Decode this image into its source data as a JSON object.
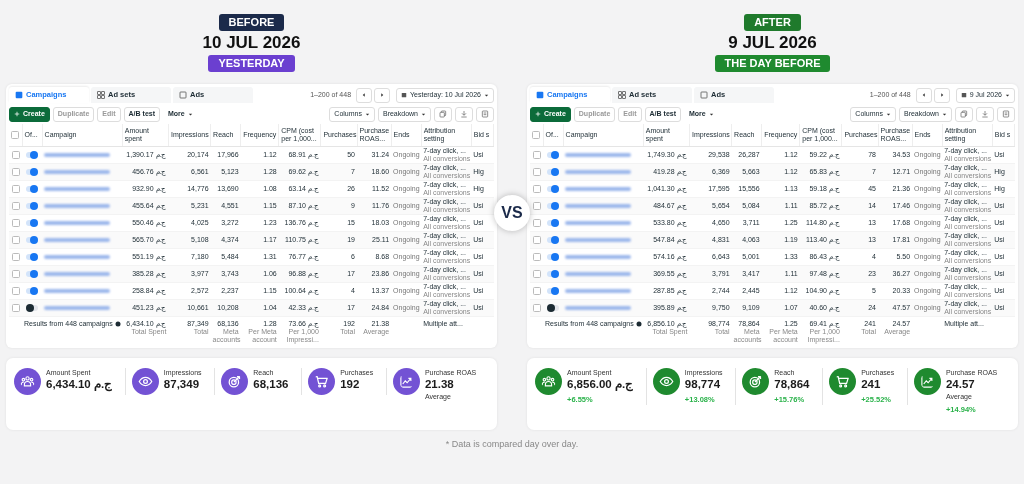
{
  "panels": [
    {
      "badge": {
        "text": "BEFORE",
        "color": "#1b2a4a"
      },
      "date": "10 JUL 2026",
      "sub_badge": {
        "text": "YESTERDAY",
        "color": "#6b3fd0"
      },
      "color": "#7352d4",
      "tabs": [
        {
          "label": "Campaigns",
          "selected": true
        },
        {
          "label": "Ad sets",
          "selected": false
        },
        {
          "label": "Ads",
          "selected": false
        }
      ],
      "pager": "1–200 of 448",
      "date_filter": "Yesterday: 10 Jul 2026",
      "toolbar": [
        {
          "label": "Create",
          "kind": "primary",
          "disabled": false
        },
        {
          "label": "Duplicate",
          "kind": "plain",
          "disabled": true
        },
        {
          "label": "Edit",
          "kind": "plain",
          "disabled": true
        },
        {
          "label": "A/B test",
          "kind": "plain",
          "disabled": false
        },
        {
          "label": "More",
          "kind": "menu",
          "disabled": false
        }
      ],
      "right_tools": [
        "Columns",
        "Breakdown"
      ],
      "select_all": false,
      "headers": [
        "Of...",
        "Campaign",
        "Amount spent",
        "Impressions",
        "Reach",
        "Frequency",
        "CPM (cost per 1,000...",
        "Purchases",
        "Purchase ROAS...",
        "Ends",
        "Attribution setting",
        "Bid s"
      ],
      "rows": [
        {
          "checked": false,
          "on": true,
          "amount_spent": "1,390.17 ج.م",
          "impressions": "20,174",
          "reach": "17,966",
          "frequency": "1.12",
          "cpm": "68.91 ج.م",
          "purchases": "50",
          "purchase_roas": "31.24",
          "ends": "Ongoing",
          "attribution": "7-day click, ...",
          "attribution_note": "All conversions",
          "bid": "Usi"
        },
        {
          "checked": false,
          "on": true,
          "amount_spent": "456.76 ج.م",
          "impressions": "6,561",
          "reach": "5,123",
          "frequency": "1.28",
          "cpm": "69.62 ج.م",
          "purchases": "7",
          "purchase_roas": "18.60",
          "ends": "Ongoing",
          "attribution": "7-day click, ...",
          "attribution_note": "All conversions",
          "bid": "Hig"
        },
        {
          "checked": false,
          "on": true,
          "amount_spent": "932.90 ج.م",
          "impressions": "14,776",
          "reach": "13,690",
          "frequency": "1.08",
          "cpm": "63.14 ج.م",
          "purchases": "26",
          "purchase_roas": "11.52",
          "ends": "Ongoing",
          "attribution": "7-day click, ...",
          "attribution_note": "All conversions",
          "bid": "Hig"
        },
        {
          "checked": false,
          "on": true,
          "amount_spent": "455.64 ج.م",
          "impressions": "5,231",
          "reach": "4,551",
          "frequency": "1.15",
          "cpm": "87.10 ج.م",
          "purchases": "9",
          "purchase_roas": "11.76",
          "ends": "Ongoing",
          "attribution": "7-day click, ...",
          "attribution_note": "All conversions",
          "bid": "Usi"
        },
        {
          "checked": false,
          "on": true,
          "amount_spent": "550.46 ج.م",
          "impressions": "4,025",
          "reach": "3,272",
          "frequency": "1.23",
          "cpm": "136.76 ج.م",
          "purchases": "15",
          "purchase_roas": "18.03",
          "ends": "Ongoing",
          "attribution": "7-day click, ...",
          "attribution_note": "All conversions",
          "bid": "Usi"
        },
        {
          "checked": false,
          "on": true,
          "amount_spent": "565.70 ج.م",
          "impressions": "5,108",
          "reach": "4,374",
          "frequency": "1.17",
          "cpm": "110.75 ج.م",
          "purchases": "19",
          "purchase_roas": "25.11",
          "ends": "Ongoing",
          "attribution": "7-day click, ...",
          "attribution_note": "All conversions",
          "bid": "Usi"
        },
        {
          "checked": false,
          "on": true,
          "amount_spent": "551.19 ج.م",
          "impressions": "7,180",
          "reach": "5,484",
          "frequency": "1.31",
          "cpm": "76.77 ج.م",
          "purchases": "6",
          "purchase_roas": "8.68",
          "ends": "Ongoing",
          "attribution": "7-day click, ...",
          "attribution_note": "All conversions",
          "bid": "Usi"
        },
        {
          "checked": false,
          "on": true,
          "amount_spent": "385.28 ج.م",
          "impressions": "3,977",
          "reach": "3,743",
          "frequency": "1.06",
          "cpm": "96.88 ج.م",
          "purchases": "17",
          "purchase_roas": "23.86",
          "ends": "Ongoing",
          "attribution": "7-day click, ...",
          "attribution_note": "All conversions",
          "bid": "Usi"
        },
        {
          "checked": false,
          "on": true,
          "amount_spent": "258.84 ج.م",
          "impressions": "2,572",
          "reach": "2,237",
          "frequency": "1.15",
          "cpm": "100.64 ج.م",
          "purchases": "4",
          "purchase_roas": "13.37",
          "ends": "Ongoing",
          "attribution": "7-day click, ...",
          "attribution_note": "All conversions",
          "bid": "Usi"
        },
        {
          "checked": false,
          "on": false,
          "amount_spent": "451.23 ج.م",
          "impressions": "10,661",
          "reach": "10,208",
          "frequency": "1.04",
          "cpm": "42.33 ج.م",
          "purchases": "17",
          "purchase_roas": "24.84",
          "ends": "Ongoing",
          "attribution": "7-day click, ...",
          "attribution_note": "All conversions",
          "bid": "Usi"
        }
      ],
      "totals": {
        "label": "Results from 448 campaigns",
        "values": [
          {
            "value": "6,434.10 ج.م",
            "note": "Total Spent"
          },
          {
            "value": "87,349",
            "note": "Total"
          },
          {
            "value": "68,136",
            "note": "Meta accounts"
          },
          {
            "value": "1.28",
            "note": "Per Meta account"
          },
          {
            "value": "73.66 ج.م",
            "note": "Per 1,000 Impressi..."
          },
          {
            "value": "192",
            "note": "Total"
          },
          {
            "value": "21.38",
            "note": "Average"
          }
        ],
        "attribution": "Multiple att..."
      },
      "stats": [
        {
          "label": "Amount Spent",
          "value": "6,434.10 ج.م"
        },
        {
          "label": "Impressions",
          "value": "87,349"
        },
        {
          "label": "Reach",
          "value": "68,136"
        },
        {
          "label": "Purchases",
          "value": "192"
        },
        {
          "label": "Purchase ROAS",
          "value": "21.38",
          "sub": "Average"
        }
      ]
    },
    {
      "badge": {
        "text": "AFTER",
        "color": "#1f7a2c"
      },
      "date": "9 JUL 2026",
      "sub_badge": {
        "text": "THE DAY BEFORE",
        "color": "#1f8a2f"
      },
      "color": "#1f8a2f",
      "tabs": [
        {
          "label": "Campaigns",
          "selected": true
        },
        {
          "label": "Ad sets",
          "selected": false
        },
        {
          "label": "Ads",
          "selected": false
        }
      ],
      "pager": "1–200 of 448",
      "date_filter": "9 Jul 2026",
      "toolbar": [
        {
          "label": "Create",
          "kind": "primary",
          "disabled": false
        },
        {
          "label": "Duplicate",
          "kind": "plain",
          "disabled": true
        },
        {
          "label": "Edit",
          "kind": "plain",
          "disabled": true
        },
        {
          "label": "A/B test",
          "kind": "plain",
          "disabled": false
        },
        {
          "label": "More",
          "kind": "menu",
          "disabled": false
        }
      ],
      "right_tools": [
        "Columns",
        "Breakdown"
      ],
      "select_all": false,
      "headers": [
        "Of...",
        "Campaign",
        "Amount spent",
        "Impressions",
        "Reach",
        "Frequency",
        "CPM (cost per 1,000...",
        "Purchases",
        "Purchase ROAS...",
        "Ends",
        "Attribution setting",
        "Bid s"
      ],
      "rows": [
        {
          "checked": false,
          "on": true,
          "amount_spent": "1,749.30 ج.م",
          "impressions": "29,538",
          "reach": "26,287",
          "frequency": "1.12",
          "cpm": "59.22 ج.م",
          "purchases": "78",
          "purchase_roas": "34.53",
          "ends": "Ongoing",
          "attribution": "7-day click, ...",
          "attribution_note": "All conversions",
          "bid": "Usi"
        },
        {
          "checked": false,
          "on": true,
          "amount_spent": "419.28 ج.م",
          "impressions": "6,369",
          "reach": "5,663",
          "frequency": "1.12",
          "cpm": "65.83 ج.م",
          "purchases": "7",
          "purchase_roas": "12.71",
          "ends": "Ongoing",
          "attribution": "7-day click, ...",
          "attribution_note": "All conversions",
          "bid": "Hig"
        },
        {
          "checked": false,
          "on": true,
          "amount_spent": "1,041.30 ج.م",
          "impressions": "17,595",
          "reach": "15,556",
          "frequency": "1.13",
          "cpm": "59.18 ج.م",
          "purchases": "45",
          "purchase_roas": "21.36",
          "ends": "Ongoing",
          "attribution": "7-day click, ...",
          "attribution_note": "All conversions",
          "bid": "Hig"
        },
        {
          "checked": false,
          "on": true,
          "amount_spent": "484.67 ج.م",
          "impressions": "5,654",
          "reach": "5,084",
          "frequency": "1.11",
          "cpm": "85.72 ج.م",
          "purchases": "14",
          "purchase_roas": "17.46",
          "ends": "Ongoing",
          "attribution": "7-day click, ...",
          "attribution_note": "All conversions",
          "bid": "Usi"
        },
        {
          "checked": false,
          "on": true,
          "amount_spent": "533.80 ج.م",
          "impressions": "4,650",
          "reach": "3,711",
          "frequency": "1.25",
          "cpm": "114.80 ج.م",
          "purchases": "13",
          "purchase_roas": "17.68",
          "ends": "Ongoing",
          "attribution": "7-day click, ...",
          "attribution_note": "All conversions",
          "bid": "Usi"
        },
        {
          "checked": false,
          "on": true,
          "amount_spent": "547.84 ج.م",
          "impressions": "4,831",
          "reach": "4,063",
          "frequency": "1.19",
          "cpm": "113.40 ج.م",
          "purchases": "13",
          "purchase_roas": "17.81",
          "ends": "Ongoing",
          "attribution": "7-day click, ...",
          "attribution_note": "All conversions",
          "bid": "Usi"
        },
        {
          "checked": false,
          "on": true,
          "amount_spent": "574.16 ج.م",
          "impressions": "6,643",
          "reach": "5,001",
          "frequency": "1.33",
          "cpm": "86.43 ج.م",
          "purchases": "4",
          "purchase_roas": "5.50",
          "ends": "Ongoing",
          "attribution": "7-day click, ...",
          "attribution_note": "All conversions",
          "bid": "Usi"
        },
        {
          "checked": false,
          "on": true,
          "amount_spent": "369.55 ج.م",
          "impressions": "3,791",
          "reach": "3,417",
          "frequency": "1.11",
          "cpm": "97.48 ج.م",
          "purchases": "23",
          "purchase_roas": "36.27",
          "ends": "Ongoing",
          "attribution": "7-day click, ...",
          "attribution_note": "All conversions",
          "bid": "Usi"
        },
        {
          "checked": false,
          "on": true,
          "amount_spent": "287.85 ج.م",
          "impressions": "2,744",
          "reach": "2,445",
          "frequency": "1.12",
          "cpm": "104.90 ج.م",
          "purchases": "5",
          "purchase_roas": "20.33",
          "ends": "Ongoing",
          "attribution": "7-day click, ...",
          "attribution_note": "All conversions",
          "bid": "Usi"
        },
        {
          "checked": false,
          "on": false,
          "amount_spent": "395.89 ج.م",
          "impressions": "9,750",
          "reach": "9,109",
          "frequency": "1.07",
          "cpm": "40.60 ج.م",
          "purchases": "24",
          "purchase_roas": "47.57",
          "ends": "Ongoing",
          "attribution": "7-day click, ...",
          "attribution_note": "All conversions",
          "bid": "Usi"
        }
      ],
      "totals": {
        "label": "Results from 448 campaigns",
        "values": [
          {
            "value": "6,856.10 ج.م",
            "note": "Total Spent"
          },
          {
            "value": "98,774",
            "note": "Total"
          },
          {
            "value": "78,864",
            "note": "Meta accounts"
          },
          {
            "value": "1.25",
            "note": "Per Meta account"
          },
          {
            "value": "69.41 ج.م",
            "note": "Per 1,000 Impressi..."
          },
          {
            "value": "241",
            "note": "Total"
          },
          {
            "value": "24.57",
            "note": "Average"
          }
        ],
        "attribution": "Multiple att..."
      },
      "stats": [
        {
          "label": "Amount Spent",
          "value": "6,856.00 ج.م",
          "change": "+6.55%"
        },
        {
          "label": "Impressions",
          "value": "98,774",
          "change": "+13.08%"
        },
        {
          "label": "Reach",
          "value": "78,864",
          "change": "+15.76%"
        },
        {
          "label": "Purchases",
          "value": "241",
          "change": "+25.52%"
        },
        {
          "label": "Purchase ROAS",
          "value": "24.57",
          "sub": "Average",
          "change": "+14.94%"
        }
      ]
    }
  ],
  "vs": "VS",
  "footnote": "* Data is compared day over day."
}
